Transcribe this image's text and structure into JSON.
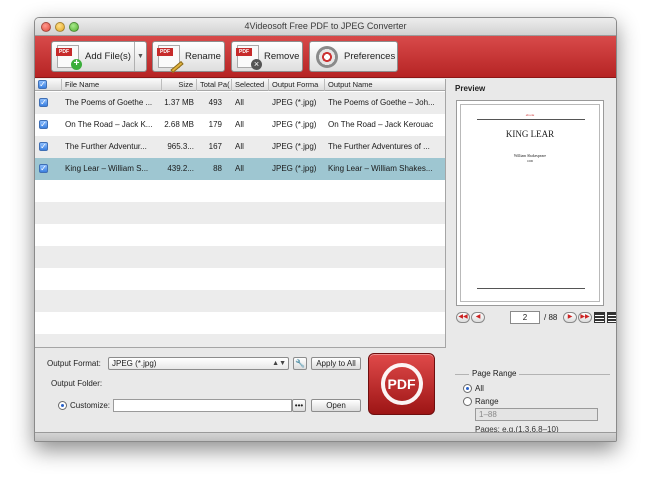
{
  "window": {
    "title": "4Videosoft Free PDF to JPEG Converter"
  },
  "toolbar": {
    "add_label": "Add File(s)",
    "rename_label": "Rename",
    "remove_label": "Remove",
    "preferences_label": "Preferences",
    "pdf_tag": "PDF"
  },
  "table": {
    "headers": [
      "File Name",
      "Size",
      "Total Pa(",
      "Selected",
      "Output Forma",
      "Output Name"
    ],
    "rows": [
      {
        "name": "The Poems of Goethe ...",
        "size": "1.37 MB",
        "pages": "493",
        "selected": "All",
        "format": "JPEG (*.jpg)",
        "output": "The Poems of Goethe – Joh..."
      },
      {
        "name": "On The Road – Jack K...",
        "size": "2.68 MB",
        "pages": "179",
        "selected": "All",
        "format": "JPEG (*.jpg)",
        "output": "On The Road – Jack Kerouac"
      },
      {
        "name": "The Further Adventur...",
        "size": "965.3...",
        "pages": "167",
        "selected": "All",
        "format": "JPEG (*.jpg)",
        "output": "The Further Adventures of ..."
      },
      {
        "name": "King Lear – William S...",
        "size": "439.2...",
        "pages": "88",
        "selected": "All",
        "format": "JPEG (*.jpg)",
        "output": "King Lear – William Shakes..."
      }
    ]
  },
  "output": {
    "format_label": "Output Format:",
    "format_value": "JPEG (*.jpg)",
    "apply_all_label": "Apply to All",
    "folder_label": "Output Folder:",
    "customize_label": "Customize:",
    "folder_value": "",
    "browse_label": "•••",
    "open_label": "Open",
    "convert_label": "PDF"
  },
  "preview": {
    "title": "Preview",
    "page_title": "KING LEAR",
    "page_author": "William Shakespeare",
    "page_top_note": "ebook",
    "page_sub_note": "1606",
    "current_page": "2",
    "total_pages": "/ 88"
  },
  "page_range": {
    "title": "Page Range",
    "all_label": "All",
    "range_label": "Range",
    "range_placeholder": "1–88",
    "hint": "Pages: e.g.(1,3,6,8–10)"
  },
  "colors": {
    "toolbar_red": "#c63232",
    "selected_row": "#9ec6d1",
    "accent_blue": "#3a7fe0"
  }
}
